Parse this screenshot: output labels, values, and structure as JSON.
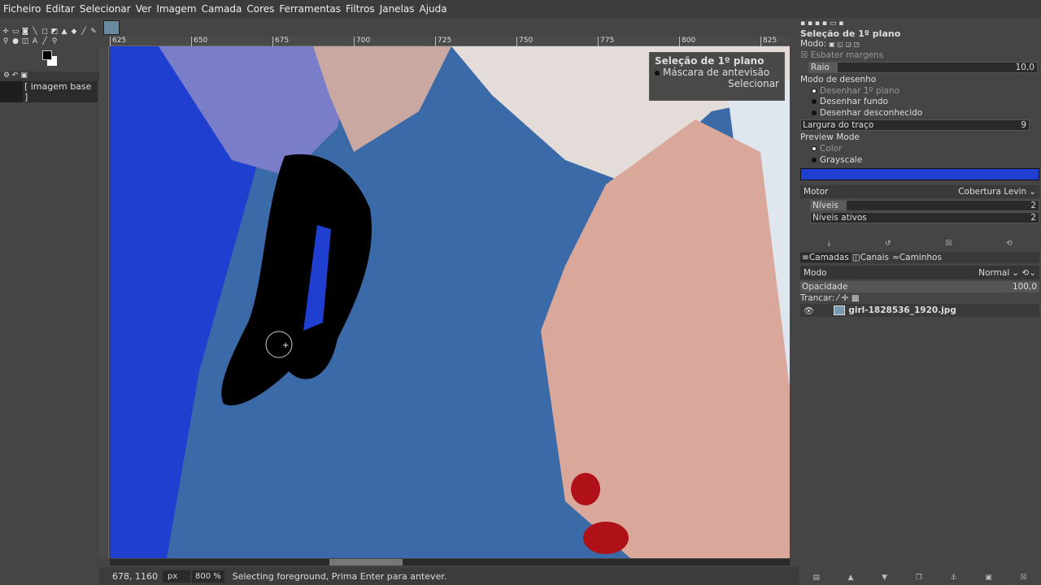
{
  "menu": [
    "Ficheiro",
    "Editar",
    "Selecionar",
    "Ver",
    "Imagem",
    "Camada",
    "Cores",
    "Ferramentas",
    "Filtros",
    "Janelas",
    "Ajuda"
  ],
  "left": {
    "image_label": "[ imagem base ]"
  },
  "ruler": {
    "h": [
      "625",
      "650",
      "675",
      "700",
      "725",
      "750",
      "775",
      "800",
      "825"
    ]
  },
  "fg_overlay": {
    "title": "Seleção de 1º plano",
    "mask_label": "Máscara de antevisão",
    "select_button": "Selecionar"
  },
  "status": {
    "coords": "678, 1160",
    "unit": "px",
    "zoom": "800 %",
    "message": "Selecting foreground, Prima Enter para antever."
  },
  "tool_options": {
    "title": "Seleção de 1º plano",
    "mode_label": "Modo:",
    "feather": "Esbater margens",
    "radius_label": "Raio",
    "radius_value": "10,0",
    "draw_mode_label": "Modo de desenho",
    "draw_modes": [
      "Desenhar 1º plano",
      "Desenhar fundo",
      "Desenhar desconhecido"
    ],
    "stroke_label": "Largura do traço",
    "stroke_value": "9",
    "preview_label": "Preview Mode",
    "preview_modes": [
      "Color",
      "Grayscale"
    ],
    "preview_color": "#1f3fd0",
    "engine_label": "Motor",
    "engine_value": "Cobertura Levin",
    "levels_label": "Níveis",
    "levels_value": "2",
    "active_levels_label": "Níveis ativos",
    "active_levels_value": "2"
  },
  "layers": {
    "tabs": [
      "Camadas",
      "Canais",
      "Caminhos"
    ],
    "mode_label": "Modo",
    "mode_value": "Normal",
    "opacity_label": "Opacidade",
    "opacity_value": "100,0",
    "lock_label": "Trancar:",
    "items": [
      {
        "name": "girl-1828536_1920.jpg"
      }
    ]
  }
}
